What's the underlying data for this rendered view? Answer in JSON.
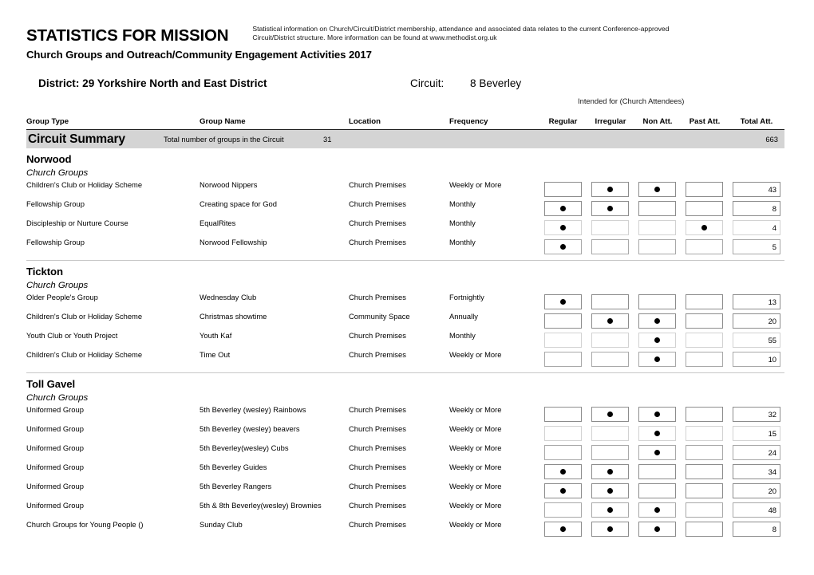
{
  "header": {
    "main_title": "STATISTICS FOR MISSION",
    "blurb": "Statistical information on Church/Circuit/District membership, attendance and associated data relates to the current Conference-approved Circuit/District structure. More information can be found at www.methodist.org.uk",
    "sub_title": "Church Groups and Outreach/Community Engagement Activities 2017"
  },
  "context": {
    "district_label": "District:",
    "district_value": "29 Yorkshire North and East District",
    "circuit_label": "Circuit:",
    "circuit_value": "8 Beverley"
  },
  "table": {
    "group_caption": "Intended for (Church Attendees)",
    "columns": {
      "group_type": "Group Type",
      "group_name": "Group Name",
      "location": "Location",
      "frequency": "Frequency",
      "regular": "Regular",
      "irregular": "Irregular",
      "non_att": "Non Att.",
      "past_att": "Past Att.",
      "total_att": "Total Att."
    }
  },
  "summary": {
    "title": "Circuit Summary",
    "description": "Total number of groups in the Circuit",
    "count": "31",
    "total": "663"
  },
  "sections": [
    {
      "church": "Norwood",
      "group_kind": "Church Groups",
      "rows": [
        {
          "type": "Children's Club or Holiday Scheme",
          "name": "Norwood Nippers",
          "location": "Church Premises",
          "frequency": "Weekly or More",
          "regular": false,
          "irregular": true,
          "non_att": true,
          "past_att": false,
          "total": "43",
          "border": "dark"
        },
        {
          "type": "Fellowship Group",
          "name": "Creating space for God",
          "location": "Church Premises",
          "frequency": "Monthly",
          "regular": true,
          "irregular": true,
          "non_att": false,
          "past_att": false,
          "total": "8",
          "border": "dark"
        },
        {
          "type": "Discipleship or Nurture Course",
          "name": "EqualRites",
          "location": "Church Premises",
          "frequency": "Monthly",
          "regular": true,
          "irregular": false,
          "non_att": false,
          "past_att": true,
          "total": "4",
          "border": "faint"
        },
        {
          "type": "Fellowship Group",
          "name": "Norwood Fellowship",
          "location": "Church Premises",
          "frequency": "Monthly",
          "regular": true,
          "irregular": false,
          "non_att": false,
          "past_att": false,
          "total": "5",
          "border": "normal"
        }
      ]
    },
    {
      "church": "Tickton",
      "group_kind": "Church Groups",
      "rows": [
        {
          "type": "Older People's Group",
          "name": "Wednesday Club",
          "location": "Church Premises",
          "frequency": "Fortnightly",
          "regular": true,
          "irregular": false,
          "non_att": false,
          "past_att": false,
          "total": "13",
          "border": "dark"
        },
        {
          "type": "Children's Club or Holiday Scheme",
          "name": "Christmas showtime",
          "location": "Community Space",
          "frequency": "Annually",
          "regular": false,
          "irregular": true,
          "non_att": true,
          "past_att": false,
          "total": "20",
          "border": "dark"
        },
        {
          "type": "Youth Club or Youth Project",
          "name": "Youth Kaf",
          "location": "Church Premises",
          "frequency": "Monthly",
          "regular": false,
          "irregular": false,
          "non_att": true,
          "past_att": false,
          "total": "55",
          "border": "faint"
        },
        {
          "type": "Children's Club or Holiday Scheme",
          "name": "Time Out",
          "location": "Church Premises",
          "frequency": "Weekly or More",
          "regular": false,
          "irregular": false,
          "non_att": true,
          "past_att": false,
          "total": "10",
          "border": "normal"
        }
      ]
    },
    {
      "church": "Toll Gavel",
      "group_kind": "Church Groups",
      "rows": [
        {
          "type": "Uniformed Group",
          "name": "5th Beverley (wesley) Rainbows",
          "location": "Church Premises",
          "frequency": "Weekly or More",
          "regular": false,
          "irregular": true,
          "non_att": true,
          "past_att": false,
          "total": "32",
          "border": "dark"
        },
        {
          "type": "Uniformed Group",
          "name": "5th Beverley (wesley) beavers",
          "location": "Church Premises",
          "frequency": "Weekly or More",
          "regular": false,
          "irregular": false,
          "non_att": true,
          "past_att": false,
          "total": "15",
          "border": "faint"
        },
        {
          "type": "Uniformed Group",
          "name": "5th Beverley(wesley) Cubs",
          "location": "Church Premises",
          "frequency": "Weekly or More",
          "regular": false,
          "irregular": false,
          "non_att": true,
          "past_att": false,
          "total": "24",
          "border": "normal"
        },
        {
          "type": "Uniformed Group",
          "name": "5th Beverley Guides",
          "location": "Church Premises",
          "frequency": "Weekly or More",
          "regular": true,
          "irregular": true,
          "non_att": false,
          "past_att": false,
          "total": "34",
          "border": "dark"
        },
        {
          "type": "Uniformed Group",
          "name": "5th Beverley Rangers",
          "location": "Church Premises",
          "frequency": "Weekly or More",
          "regular": true,
          "irregular": true,
          "non_att": false,
          "past_att": false,
          "total": "20",
          "border": "dark"
        },
        {
          "type": "Uniformed Group",
          "name": "5th & 8th Beverley(wesley) Brownies",
          "location": "Church Premises",
          "frequency": "Weekly or More",
          "regular": false,
          "irregular": true,
          "non_att": true,
          "past_att": false,
          "total": "48",
          "border": "normal"
        },
        {
          "type": "Church Groups for Young People ()",
          "name": "Sunday Club",
          "location": "Church Premises",
          "frequency": "Weekly or More",
          "regular": true,
          "irregular": true,
          "non_att": true,
          "past_att": false,
          "total": "8",
          "border": "dark"
        }
      ]
    }
  ]
}
